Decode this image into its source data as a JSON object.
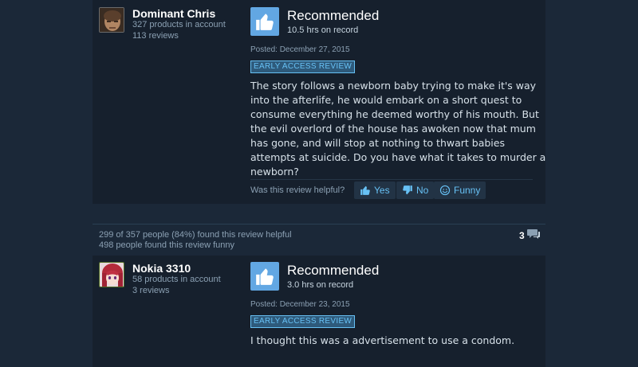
{
  "reviews": [
    {
      "user": {
        "name": "Dominant Chris",
        "products": "327 products in account",
        "reviews": "113 reviews"
      },
      "verdict": "Recommended",
      "hours": "10.5 hrs on record",
      "posted": "Posted: December 27, 2015",
      "badge": "EARLY ACCESS REVIEW",
      "text": "The story follows a newborn baby trying to make it's way into the afterlife, he would embark on a short quest to consume everything he deemed worthy of his mouth. But the evil overlord of the house has awoken now that mum has gone, and will stop at nothing to thwart babies attempts at suicide. Do you have what it takes to murder a newborn?",
      "helpful_prompt": "Was this review helpful?",
      "buttons": {
        "yes": "Yes",
        "no": "No",
        "funny": "Funny"
      }
    },
    {
      "user": {
        "name": "Nokia 3310",
        "products": "58 products in account",
        "reviews": "3 reviews"
      },
      "verdict": "Recommended",
      "hours": "3.0 hrs on record",
      "posted": "Posted: December 23, 2015",
      "badge": "EARLY ACCESS REVIEW",
      "text": "I thought this was a advertisement to use a condom."
    }
  ],
  "helpful_summary": {
    "helpful": "299 of 357 people (84%) found this review helpful",
    "funny": "498 people found this review funny",
    "comments": "3"
  },
  "icons": {
    "recommend": "thumbs-up-icon",
    "yes": "thumbs-up-icon",
    "no": "thumbs-down-icon",
    "funny": "smiley-icon",
    "comments": "comment-bubble-icon"
  },
  "colors": {
    "background": "#1b2838",
    "panel": "#16202d",
    "accent": "#67c1f5",
    "thumb_box": "#62a7e3"
  }
}
